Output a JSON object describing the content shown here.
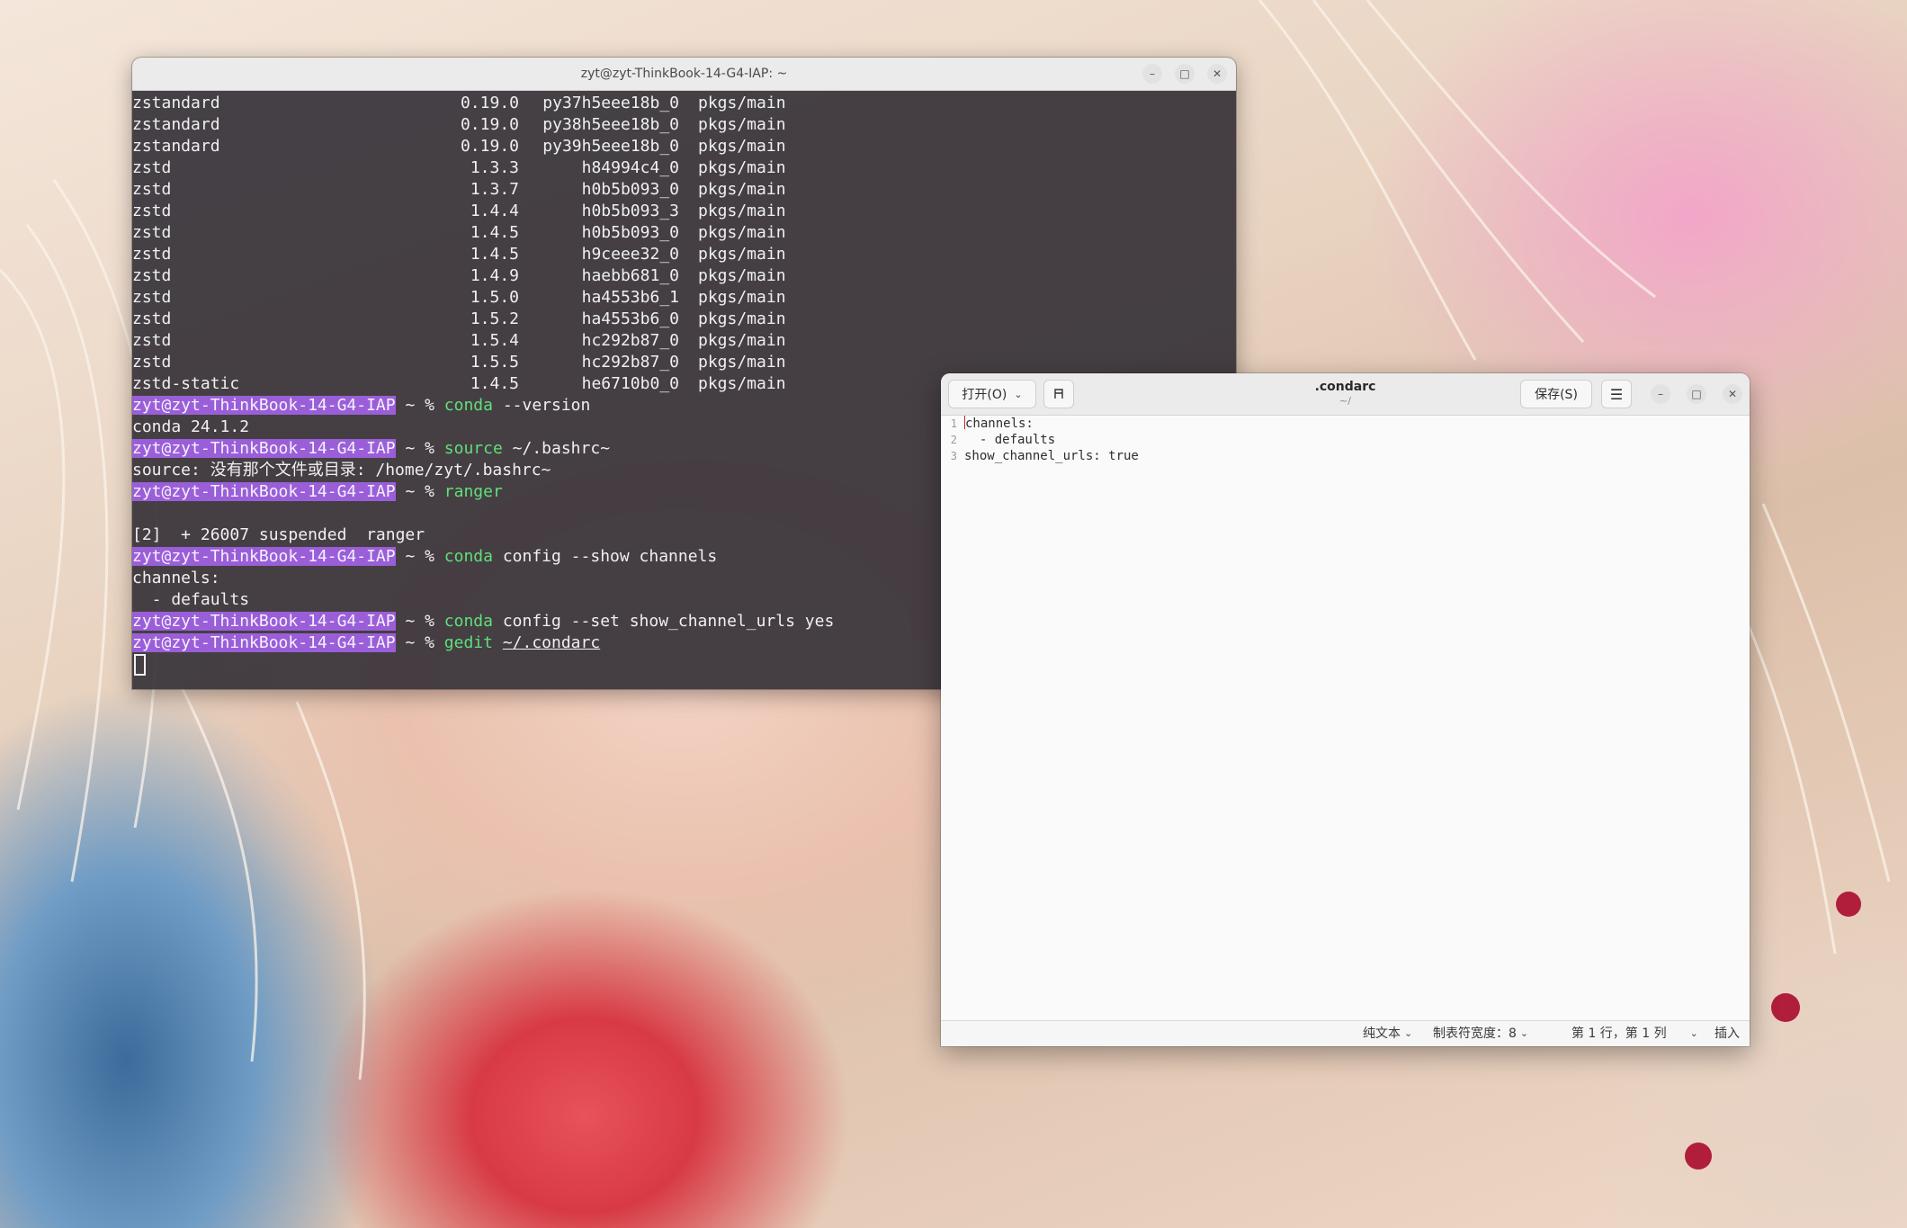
{
  "terminal": {
    "title": "zyt@zyt-ThinkBook-14-G4-IAP: ~",
    "packages": [
      {
        "name": "zstandard",
        "version": "0.19.0",
        "build": "py37h5eee18b_0",
        "channel": "pkgs/main"
      },
      {
        "name": "zstandard",
        "version": "0.19.0",
        "build": "py38h5eee18b_0",
        "channel": "pkgs/main"
      },
      {
        "name": "zstandard",
        "version": "0.19.0",
        "build": "py39h5eee18b_0",
        "channel": "pkgs/main"
      },
      {
        "name": "zstd",
        "version": "1.3.3",
        "build": "h84994c4_0",
        "channel": "pkgs/main"
      },
      {
        "name": "zstd",
        "version": "1.3.7",
        "build": "h0b5b093_0",
        "channel": "pkgs/main"
      },
      {
        "name": "zstd",
        "version": "1.4.4",
        "build": "h0b5b093_3",
        "channel": "pkgs/main"
      },
      {
        "name": "zstd",
        "version": "1.4.5",
        "build": "h0b5b093_0",
        "channel": "pkgs/main"
      },
      {
        "name": "zstd",
        "version": "1.4.5",
        "build": "h9ceee32_0",
        "channel": "pkgs/main"
      },
      {
        "name": "zstd",
        "version": "1.4.9",
        "build": "haebb681_0",
        "channel": "pkgs/main"
      },
      {
        "name": "zstd",
        "version": "1.5.0",
        "build": "ha4553b6_1",
        "channel": "pkgs/main"
      },
      {
        "name": "zstd",
        "version": "1.5.2",
        "build": "ha4553b6_0",
        "channel": "pkgs/main"
      },
      {
        "name": "zstd",
        "version": "1.5.4",
        "build": "hc292b87_0",
        "channel": "pkgs/main"
      },
      {
        "name": "zstd",
        "version": "1.5.5",
        "build": "hc292b87_0",
        "channel": "pkgs/main"
      },
      {
        "name": "zstd-static",
        "version": "1.4.5",
        "build": "he6710b0_0",
        "channel": "pkgs/main"
      }
    ],
    "prompt_host": "zyt@zyt-ThinkBook-14-G4-IAP",
    "prompt_suffix": " ~ % ",
    "session": [
      {
        "kind": "cmd",
        "cmd": "conda",
        "args": " --version"
      },
      {
        "kind": "out",
        "text": "conda 24.1.2"
      },
      {
        "kind": "cmd",
        "cmd": "source",
        "args": " ~/.bashrc~"
      },
      {
        "kind": "out",
        "text": "source: 没有那个文件或目录: /home/zyt/.bashrc~"
      },
      {
        "kind": "cmd",
        "cmd": "ranger",
        "args": ""
      },
      {
        "kind": "out",
        "text": ""
      },
      {
        "kind": "out",
        "text": "[2]  + 26007 suspended  ranger"
      },
      {
        "kind": "cmd",
        "cmd": "conda",
        "args": " config --show channels"
      },
      {
        "kind": "out",
        "text": "channels:"
      },
      {
        "kind": "out",
        "text": "  - defaults"
      },
      {
        "kind": "cmd",
        "cmd": "conda",
        "args": " config --set show_channel_urls yes"
      },
      {
        "kind": "cmd",
        "cmd": "gedit",
        "args": " ",
        "underlined": "~/.condarc"
      }
    ]
  },
  "gedit": {
    "title": ".condarc",
    "subtitle": "~/",
    "open_label": "打开(O)",
    "save_label": "保存(S)",
    "lines": [
      "channels:",
      "  - defaults",
      "show_channel_urls: true"
    ],
    "status": {
      "language": "纯文本",
      "tab_width": "制表符宽度：8",
      "position": "第 1 行，第 1 列",
      "mode": "插入"
    }
  },
  "colors": {
    "prompt_highlight": "#9a5fd8",
    "command_green": "#5fe07a",
    "terminal_bg": "#363238"
  },
  "icons": {
    "window_minimize": "minimize-icon",
    "window_maximize": "maximize-icon",
    "window_close": "close-icon",
    "pin": "pin-icon",
    "hamburger": "menu-icon",
    "dropdown": "chevron-down-icon"
  }
}
